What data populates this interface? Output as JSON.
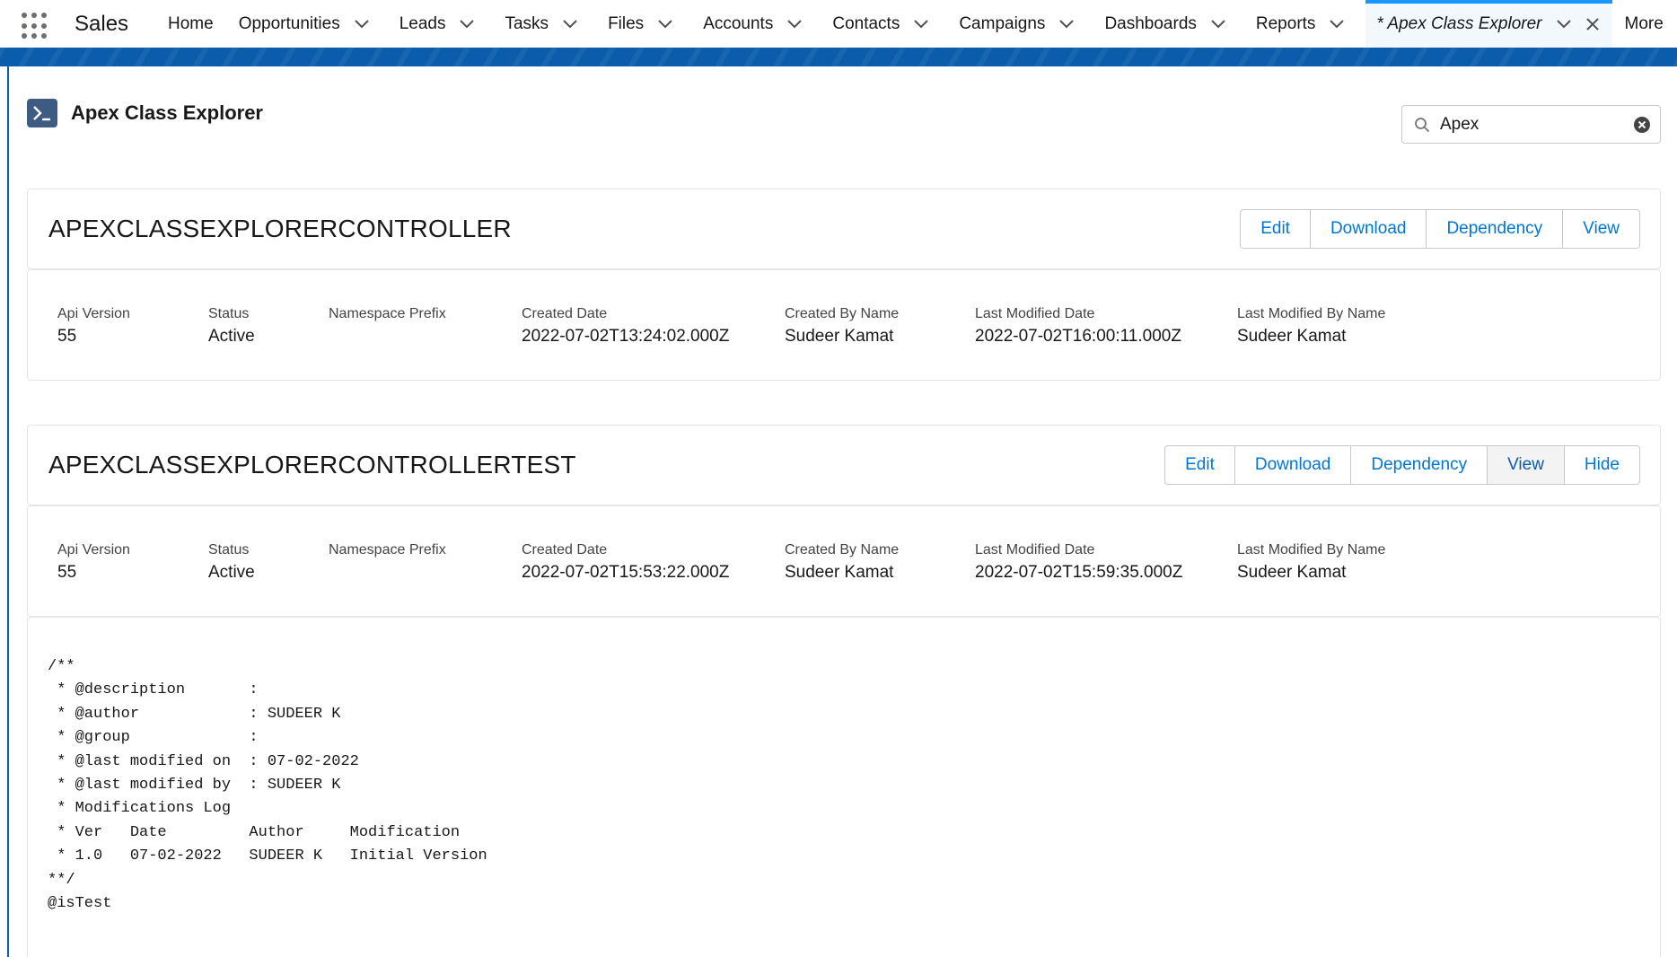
{
  "app": {
    "name": "Sales"
  },
  "nav": {
    "items": [
      {
        "label": "Home",
        "dropdown": false
      },
      {
        "label": "Opportunities",
        "dropdown": true
      },
      {
        "label": "Leads",
        "dropdown": true
      },
      {
        "label": "Tasks",
        "dropdown": true
      },
      {
        "label": "Files",
        "dropdown": true
      },
      {
        "label": "Accounts",
        "dropdown": true
      },
      {
        "label": "Contacts",
        "dropdown": true
      },
      {
        "label": "Campaigns",
        "dropdown": true
      },
      {
        "label": "Dashboards",
        "dropdown": true
      },
      {
        "label": "Reports",
        "dropdown": true
      }
    ],
    "active_tab": {
      "label": "* Apex Class Explorer"
    },
    "more_label": "More"
  },
  "colors": {
    "brand_blue": "#0b5cab",
    "link_blue": "#0176d3",
    "active_accent": "#1b96ff",
    "header_icon_bg": "#3e5b84"
  },
  "page": {
    "title": "Apex Class Explorer",
    "icon": "terminal-prompt-icon"
  },
  "search": {
    "value": "Apex"
  },
  "field_labels": {
    "api_version": "Api Version",
    "status": "Status",
    "namespace_prefix": "Namespace Prefix",
    "created_date": "Created Date",
    "created_by_name": "Created By Name",
    "last_modified_date": "Last Modified Date",
    "last_modified_by_name": "Last Modified By Name"
  },
  "classes": [
    {
      "name": "APEXCLASSEXPLORERCONTROLLER",
      "buttons": {
        "edit": "Edit",
        "download": "Download",
        "dependency": "Dependency",
        "view": "View"
      },
      "fields": {
        "api_version": "55",
        "status": "Active",
        "namespace_prefix": "",
        "created_date": "2022-07-02T13:24:02.000Z",
        "created_by_name": "Sudeer Kamat",
        "last_modified_date": "2022-07-02T16:00:11.000Z",
        "last_modified_by_name": "Sudeer Kamat"
      }
    },
    {
      "name": "APEXCLASSEXPLORERCONTROLLERTEST",
      "buttons": {
        "edit": "Edit",
        "download": "Download",
        "dependency": "Dependency",
        "view": "View",
        "hide": "Hide"
      },
      "fields": {
        "api_version": "55",
        "status": "Active",
        "namespace_prefix": "",
        "created_date": "2022-07-02T15:53:22.000Z",
        "created_by_name": "Sudeer Kamat",
        "last_modified_date": "2022-07-02T15:59:35.000Z",
        "last_modified_by_name": "Sudeer Kamat"
      },
      "code": "/**\n * @description       : \n * @author            : SUDEER K\n * @group             : \n * @last modified on  : 07-02-2022\n * @last modified by  : SUDEER K\n * Modifications Log\n * Ver   Date         Author     Modification\n * 1.0   07-02-2022   SUDEER K   Initial Version\n**/\n@isTest"
    }
  ]
}
